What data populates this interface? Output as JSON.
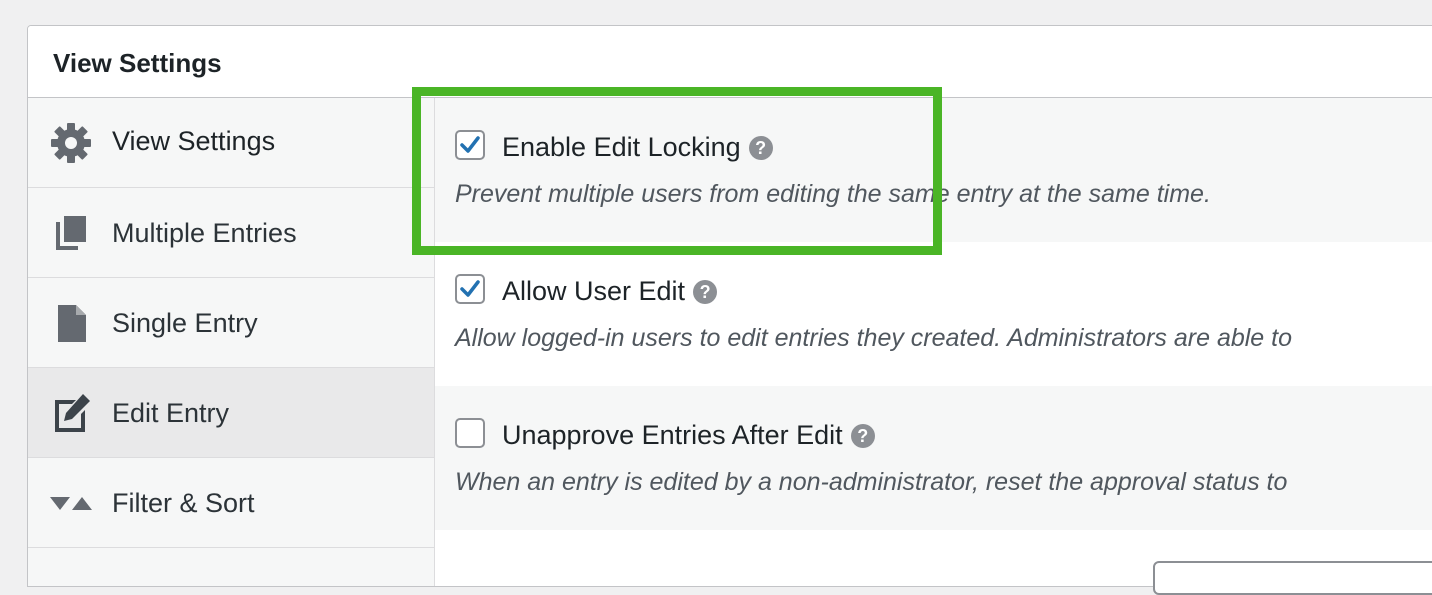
{
  "panel": {
    "title": "View Settings"
  },
  "sidebar": {
    "items": [
      {
        "label": "View Settings",
        "icon": "gear-icon",
        "active": false
      },
      {
        "label": "Multiple Entries",
        "icon": "multiple-documents-icon",
        "active": false
      },
      {
        "label": "Single Entry",
        "icon": "document-icon",
        "active": false
      },
      {
        "label": "Edit Entry",
        "icon": "edit-document-icon",
        "active": true
      },
      {
        "label": "Filter & Sort",
        "icon": "sort-icon",
        "active": false
      }
    ]
  },
  "settings": [
    {
      "label": "Enable Edit Locking",
      "checked": true,
      "help_icon": "?",
      "description": "Prevent multiple users from editing the same entry at the same time."
    },
    {
      "label": "Allow User Edit",
      "checked": true,
      "help_icon": "?",
      "description": "Allow logged-in users to edit entries they created. Administrators are able to"
    },
    {
      "label": "Unapprove Entries After Edit",
      "checked": false,
      "help_icon": "?",
      "description": "When an entry is edited by a non-administrator, reset the approval status to"
    }
  ],
  "colors": {
    "highlight": "#4ab526",
    "checkmark": "#2271b1",
    "icon_gray": "#646970"
  }
}
